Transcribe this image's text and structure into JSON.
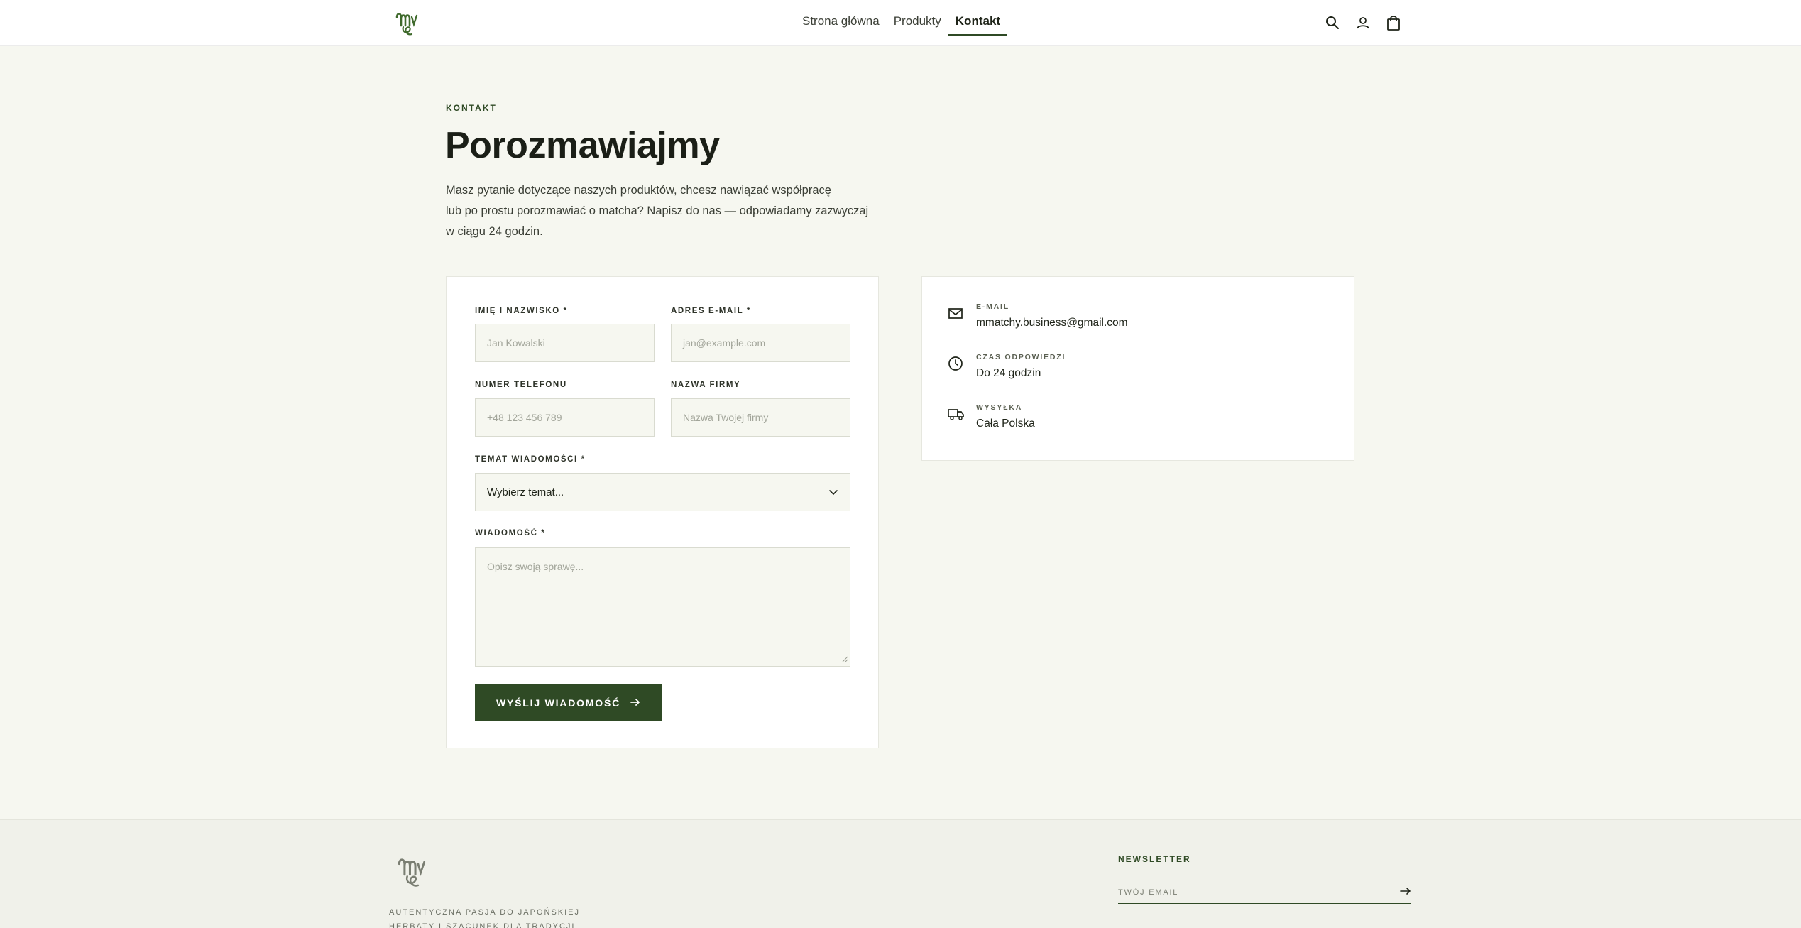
{
  "nav": {
    "items": [
      {
        "label": "Strona główna"
      },
      {
        "label": "Produkty"
      },
      {
        "label": "Kontakt"
      }
    ],
    "active": "Kontakt"
  },
  "hero": {
    "eyebrow": "KONTAKT",
    "title": "Porozmawiajmy",
    "intro_line1": "Masz pytanie dotyczące naszych produktów, chcesz nawiązać współpracę",
    "intro_line2": "lub po prostu porozmawiać o matcha? Napisz do nas — odpowiadamy zazwyczaj",
    "intro_line3": "w ciągu 24 godzin."
  },
  "form": {
    "name_label": "IMIĘ I NAZWISKO *",
    "name_placeholder": "Jan Kowalski",
    "email_label": "ADRES E-MAIL *",
    "email_placeholder": "jan@example.com",
    "phone_label": "NUMER TELEFONU",
    "phone_placeholder": "+48 123 456 789",
    "company_label": "NAZWA FIRMY",
    "company_placeholder": "Nazwa Twojej firmy",
    "topic_label": "TEMAT WIADOMOŚCI *",
    "topic_value": "Wybierz temat...",
    "message_label": "WIADOMOŚĆ *",
    "message_placeholder": "Opisz swoją sprawę...",
    "submit_label": "WYŚLIJ WIADOMOŚĆ"
  },
  "info": {
    "email_label": "E-MAIL",
    "email_value": "mmatchy.business@gmail.com",
    "response_label": "CZAS ODPOWIEDZI",
    "response_value": "Do 24 godzin",
    "shipping_label": "WYSYŁKA",
    "shipping_value": "Cała Polska"
  },
  "footer": {
    "tagline_line1": "AUTENTYCZNA PASJA DO JAPOŃSKIEJ",
    "tagline_line2": "HERBATY I SZACUNEK DLA TRADYCJI",
    "newsletter_title": "NEWSLETTER",
    "newsletter_placeholder": "TWÓJ EMAIL"
  },
  "colors": {
    "brand": "#2f4a25",
    "background": "#f6f7f0"
  }
}
